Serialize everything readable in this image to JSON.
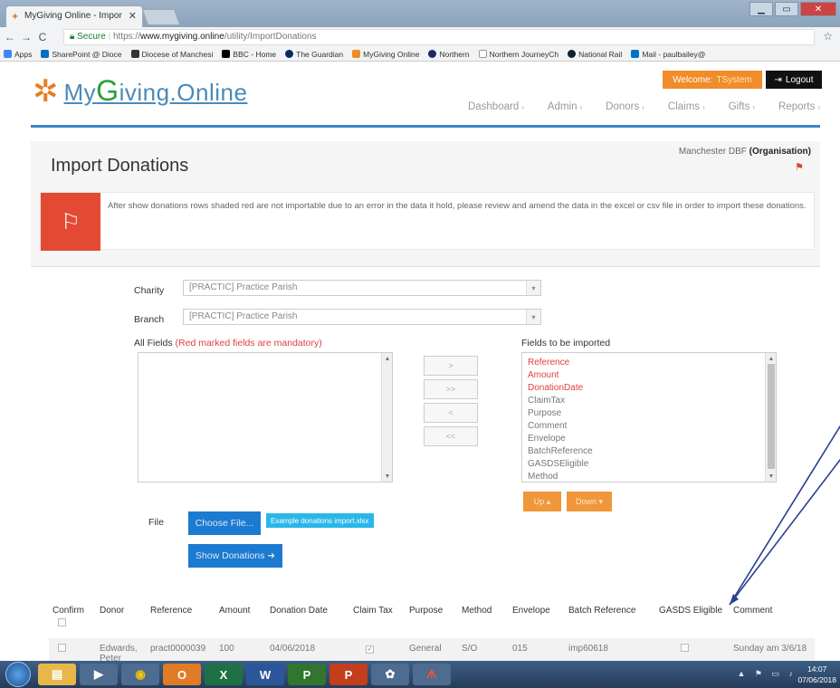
{
  "browser": {
    "tab_title": "MyGiving Online - Impor",
    "secure_label": "Secure",
    "url_scheme": "https://",
    "url_domain": "www.mygiving.online",
    "url_path": "/utility/ImportDonations",
    "bookmarks": [
      "Apps",
      "SharePoint @ Dioce",
      "Diocese of Manchesi",
      "BBC - Home",
      "The Guardian",
      "MyGiving Online",
      "Northern",
      "Northern JourneyCh",
      "National Rail",
      "Mail - paulbailey@"
    ]
  },
  "site": {
    "logo_my": "My",
    "logo_g": "G",
    "logo_rest": "iving",
    "logo_dot": ".Online",
    "welcome_label": "Welcome:",
    "welcome_user": "TSystem",
    "logout_label": "Logout",
    "nav": [
      "Dashboard",
      "Admin",
      "Donors",
      "Claims",
      "Gifts",
      "Reports"
    ]
  },
  "page": {
    "title": "Import Donations",
    "org_name": "Manchester DBF",
    "org_type": "(Organisation)",
    "alert_message": "After show donations rows shaded red are not importable due to an error in the data it hold, please review and amend the data in the excel or csv file in order to import these donations."
  },
  "form": {
    "charity_label": "Charity",
    "charity_value": "[PRACTIC] Practice Parish",
    "branch_label": "Branch",
    "branch_value": "[PRACTIC] Practice Parish",
    "all_fields_label": "All Fields",
    "all_fields_note": "(Red marked fields are mandatory)",
    "fields_to_import_label": "Fields to be imported",
    "fields_mandatory": [
      "Reference",
      "Amount",
      "DonationDate"
    ],
    "fields_optional": [
      "ClaimTax",
      "Purpose",
      "Comment",
      "Envelope",
      "BatchReference",
      "GASDSEligible",
      "Method"
    ],
    "move_buttons": [
      ">",
      ">>",
      "<",
      "<<"
    ],
    "up_label": "Up",
    "down_label": "Down",
    "file_label": "File",
    "choose_file_label": "Choose File...",
    "example_link": "Example donations import.xlsx",
    "show_donations_label": "Show Donations"
  },
  "table": {
    "headers": [
      "Confirm",
      "Donor",
      "Reference",
      "Amount",
      "Donation Date",
      "Claim Tax",
      "Purpose",
      "Method",
      "Envelope",
      "Batch Reference",
      "GASDS Eligible",
      "Comment"
    ],
    "row": {
      "donor": "Edwards, Peter",
      "reference": "pract0000039",
      "amount": "100",
      "date": "04/06/2018",
      "purpose": "General",
      "method": "S/O",
      "envelope": "015",
      "batch": "imp60618",
      "comment": "Sunday am 3/6/18"
    }
  },
  "taskbar": {
    "time": "14:07",
    "date": "07/06/2018"
  },
  "colors": {
    "accent_blue": "#3a86c8",
    "orange": "#f08c2a",
    "alert_red": "#e34a33"
  }
}
